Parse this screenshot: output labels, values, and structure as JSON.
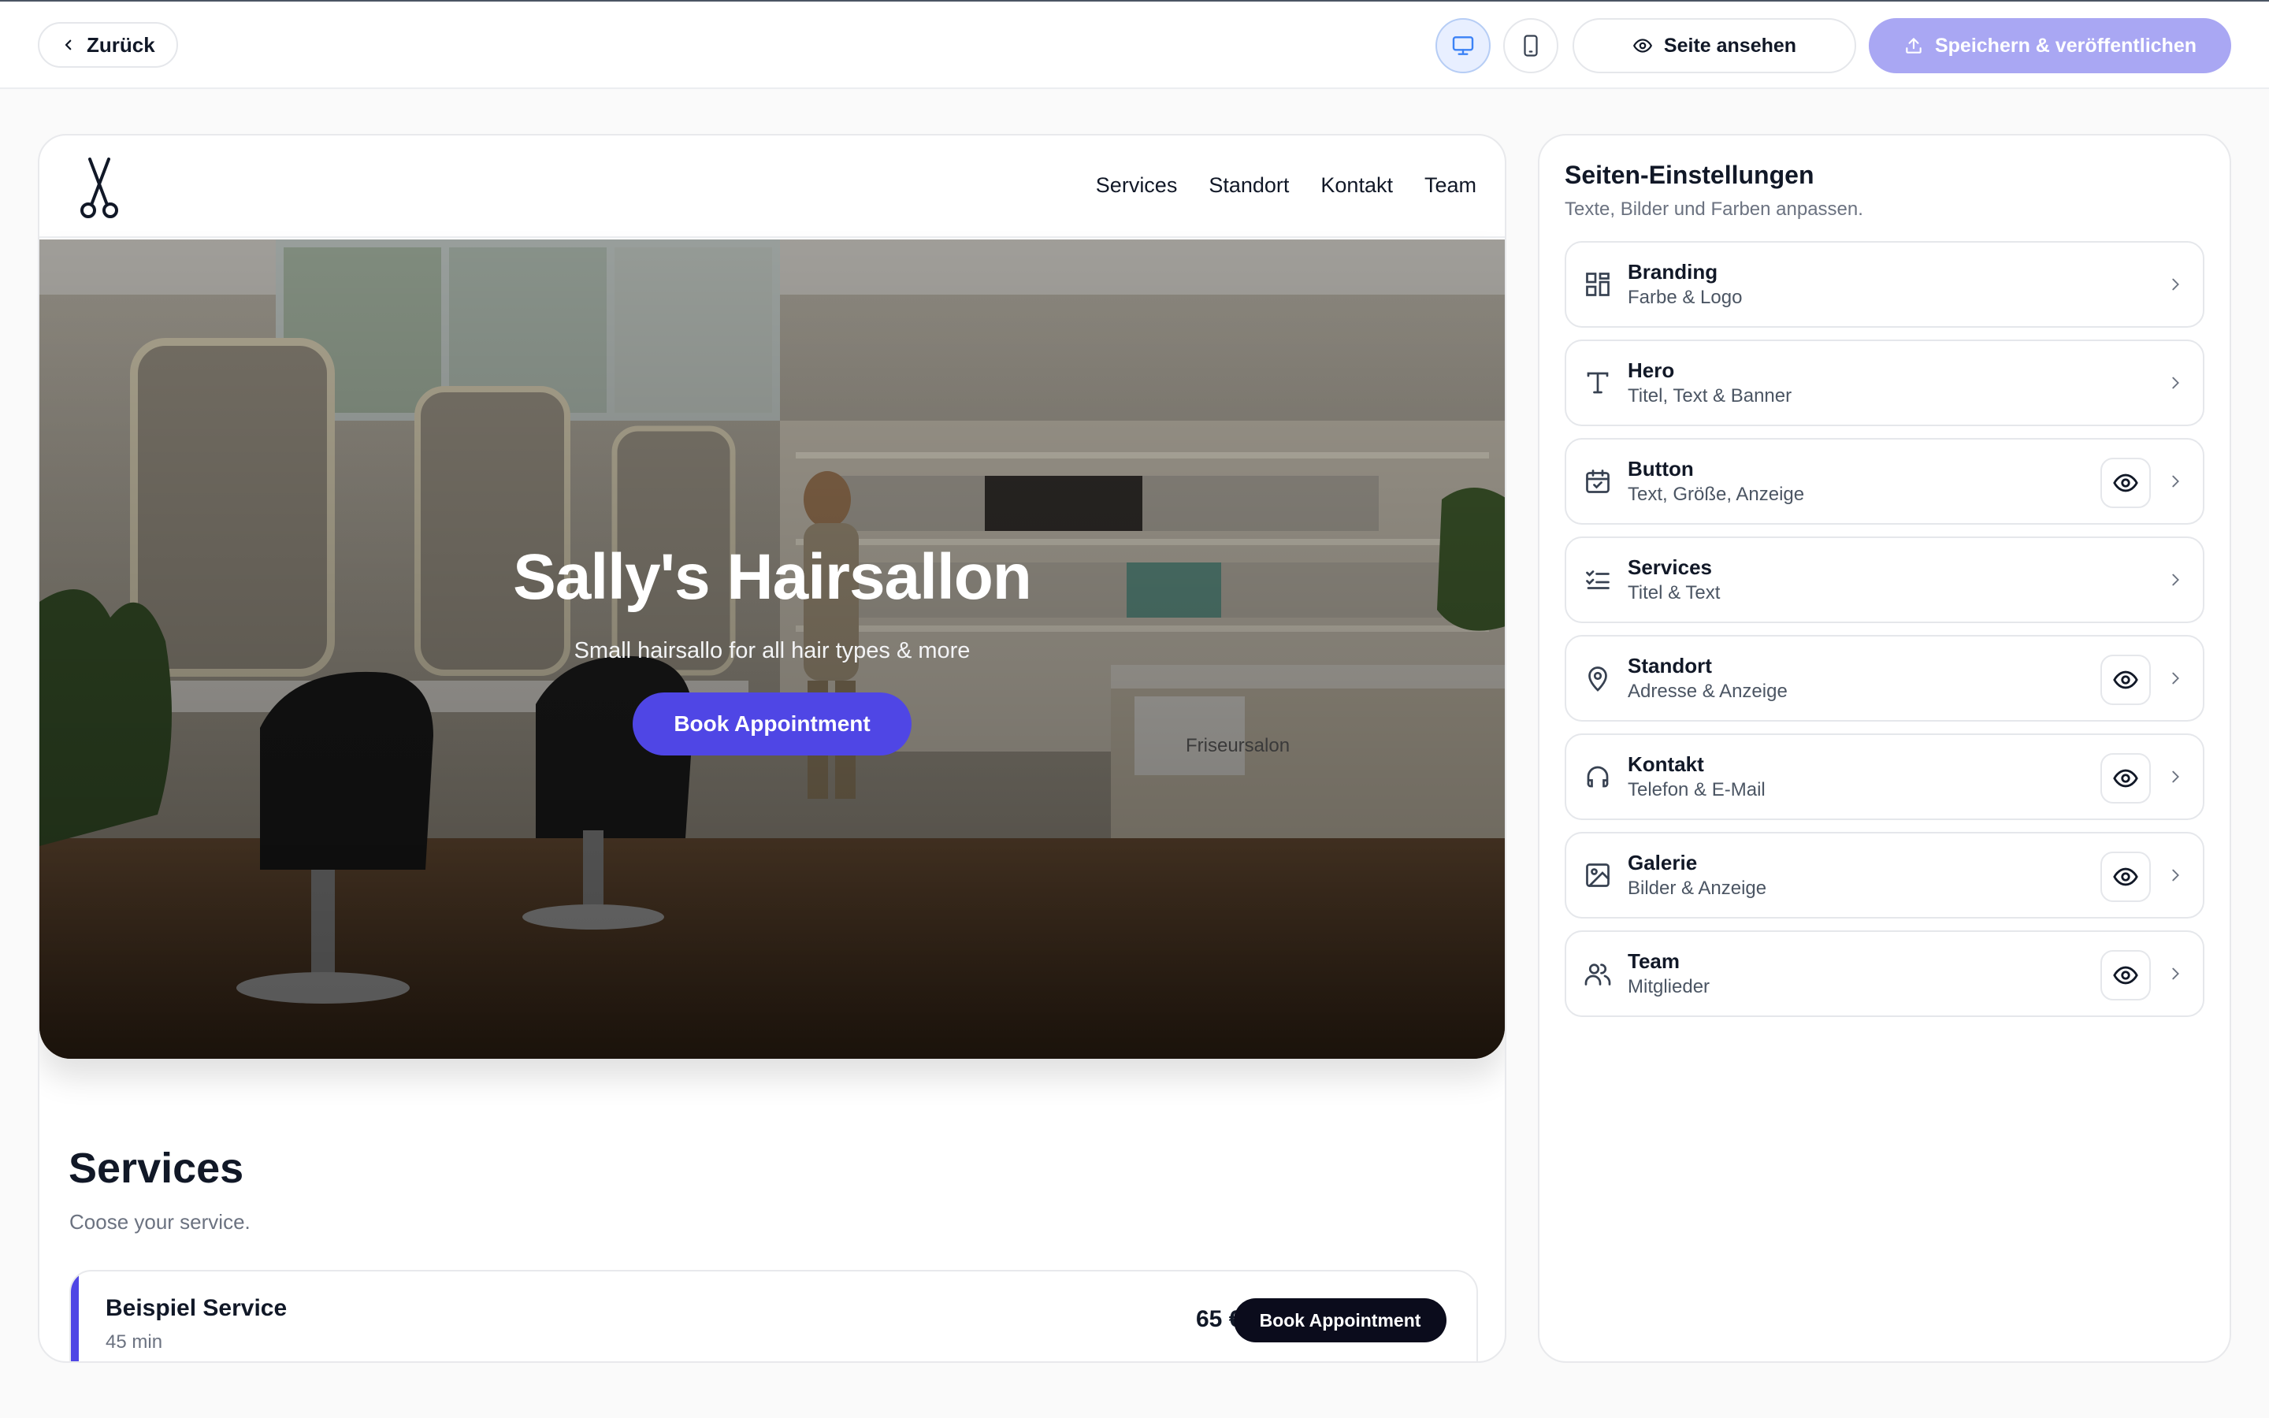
{
  "toolbar": {
    "back_label": "Zurück",
    "view_label": "Seite ansehen",
    "publish_label": "Speichern & veröffentlichen",
    "active_device": "desktop"
  },
  "site": {
    "nav": [
      "Services",
      "Standort",
      "Kontakt",
      "Team"
    ],
    "hero": {
      "title": "Sally's Hairsallon",
      "subtitle": "Small hairsallo for all hair types & more",
      "button": "Book Appointment"
    },
    "services": {
      "title": "Services",
      "subtitle": "Coose your service.",
      "items": [
        {
          "name": "Beispiel Service",
          "duration": "45 min",
          "price": "65 €",
          "button": "Book Appointment"
        }
      ]
    },
    "hero_image_sign": "Friseursalon"
  },
  "settings": {
    "title": "Seiten-Einstellungen",
    "subtitle": "Texte, Bilder und Farben anpassen.",
    "items": [
      {
        "label": "Branding",
        "desc": "Farbe & Logo",
        "icon": "layout-grid-icon",
        "visible_toggle": false
      },
      {
        "label": "Hero",
        "desc": "Titel, Text & Banner",
        "icon": "type-icon",
        "visible_toggle": false
      },
      {
        "label": "Button",
        "desc": "Text, Größe, Anzeige",
        "icon": "calendar-check-icon",
        "visible_toggle": true
      },
      {
        "label": "Services",
        "desc": "Titel & Text",
        "icon": "list-checks-icon",
        "visible_toggle": false
      },
      {
        "label": "Standort",
        "desc": "Adresse & Anzeige",
        "icon": "map-pin-icon",
        "visible_toggle": true
      },
      {
        "label": "Kontakt",
        "desc": "Telefon & E-Mail",
        "icon": "headphones-icon",
        "visible_toggle": true
      },
      {
        "label": "Galerie",
        "desc": "Bilder & Anzeige",
        "icon": "image-icon",
        "visible_toggle": true
      },
      {
        "label": "Team",
        "desc": "Mitglieder",
        "icon": "users-icon",
        "visible_toggle": true
      }
    ]
  },
  "colors": {
    "accent": "#4f46e5",
    "publish_disabled": "#a9a7f3",
    "active_device_bg": "#e8efff"
  }
}
